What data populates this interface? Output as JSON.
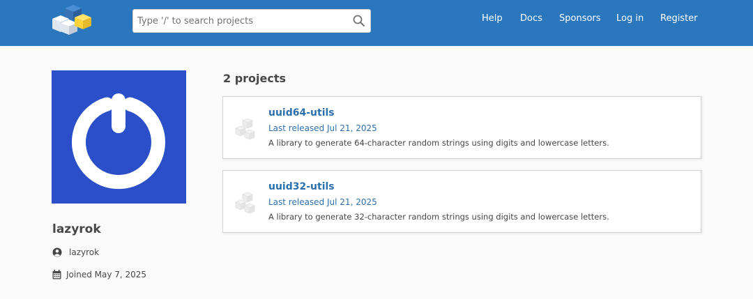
{
  "header": {
    "logo_icon": "pypi-logo-icon",
    "search": {
      "placeholder": "Type '/' to search projects",
      "value": "",
      "icon": "search-icon"
    },
    "nav": [
      {
        "label": "Help"
      },
      {
        "label": "Docs"
      },
      {
        "label": "Sponsors"
      },
      {
        "label": "Log in"
      },
      {
        "label": "Register"
      }
    ],
    "bar_color": "#2b77bd"
  },
  "profile": {
    "avatar_icon": "power-button-icon",
    "avatar_color": "#2b4fc9",
    "display_name": "lazyrok",
    "username": "lazyrok",
    "joined": "Joined May 7, 2025"
  },
  "projects": {
    "count_label": "2 projects",
    "items": [
      {
        "name": "uuid64-utils",
        "released": "Last released Jul 21, 2025",
        "description": "A library to generate 64-character random strings using digits and lowercase letters."
      },
      {
        "name": "uuid32-utils",
        "released": "Last released Jul 21, 2025",
        "description": "A library to generate 32-character random strings using digits and lowercase letters."
      }
    ],
    "link_color": "#2b6fad"
  }
}
